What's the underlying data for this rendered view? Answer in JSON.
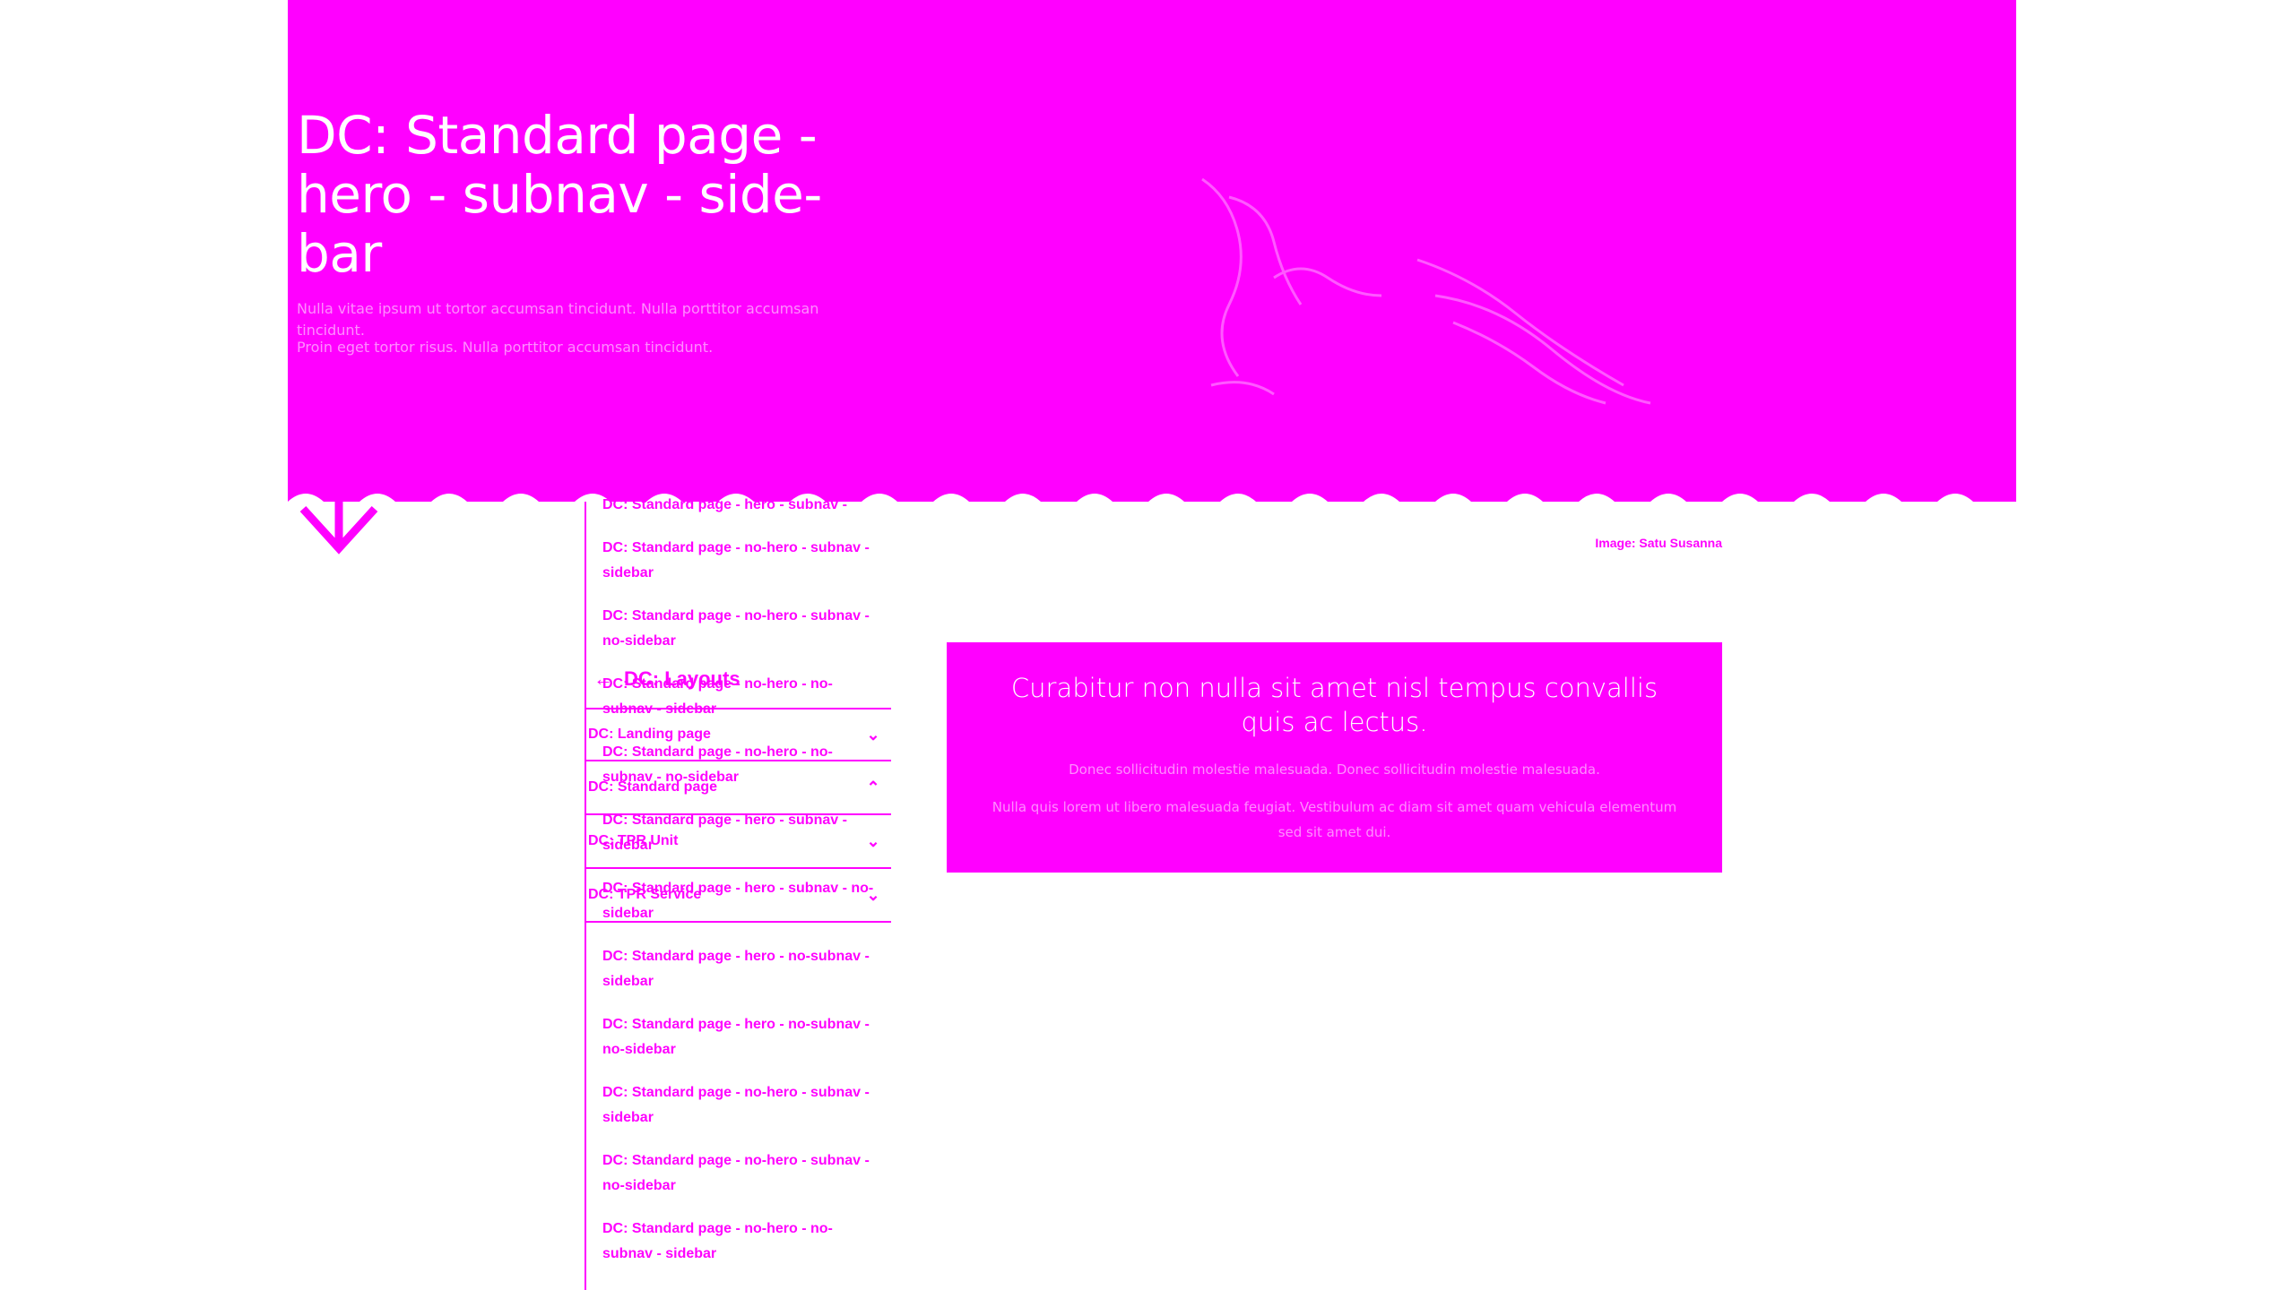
{
  "hero": {
    "title": "DC: Standard page - hero - subnav - side-bar",
    "text1": "Nulla vitae ipsum ut tortor accumsan tincidunt. Nulla porttitor accumsan tincidunt.",
    "text2": "Proin eget tortor risus. Nulla porttitor accumsan tincidunt.",
    "image_credit": "Image: Satu Susanna"
  },
  "sidebar": {
    "back_label": "DC: Layouts",
    "pages": [
      "DC: Standard page - hero - subnav - sidebar",
      "DC: Standard page - no-hero - subnav - sidebar",
      "DC: Standard page - no-hero - subnav - no-sidebar",
      "DC: Standard page - no-hero - no-subnav - sidebar",
      "DC: Standard page - no-hero - no-subnav - no-sidebar",
      "DC: Standard page - hero - subnav - sidebar",
      "DC: Standard page - hero - subnav - no-sidebar",
      "DC: Standard page - hero - no-subnav - sidebar",
      "DC: Standard page - hero - no-subnav - no-sidebar",
      "DC: Standard page - no-hero - subnav - sidebar",
      "DC: Standard page - no-hero - subnav - no-sidebar",
      "DC: Standard page - no-hero - no-subnav - sidebar"
    ],
    "sections": [
      {
        "label": "DC: Landing page",
        "icon": "chevron-down-icon"
      },
      {
        "label": "DC: Standard page",
        "icon": "chevron-up-icon"
      },
      {
        "label": "DC: TPR Unit",
        "icon": "chevron-down-icon"
      },
      {
        "label": "DC: TPR Service",
        "icon": "chevron-down-icon"
      }
    ]
  },
  "callout": {
    "title": "Curabitur non nulla sit amet nisl tempus convallis quis ac lectus.",
    "p1": "Donec sollicitudin molestie malesuada. Donec sollicitudin molestie malesuada.",
    "p2": "Nulla quis lorem ut libero malesuada feugiat. Vestibulum ac diam sit amet quam vehicula elementum sed sit amet dui."
  },
  "colors": {
    "accent": "#ff00ff",
    "background": "#ffffff"
  }
}
